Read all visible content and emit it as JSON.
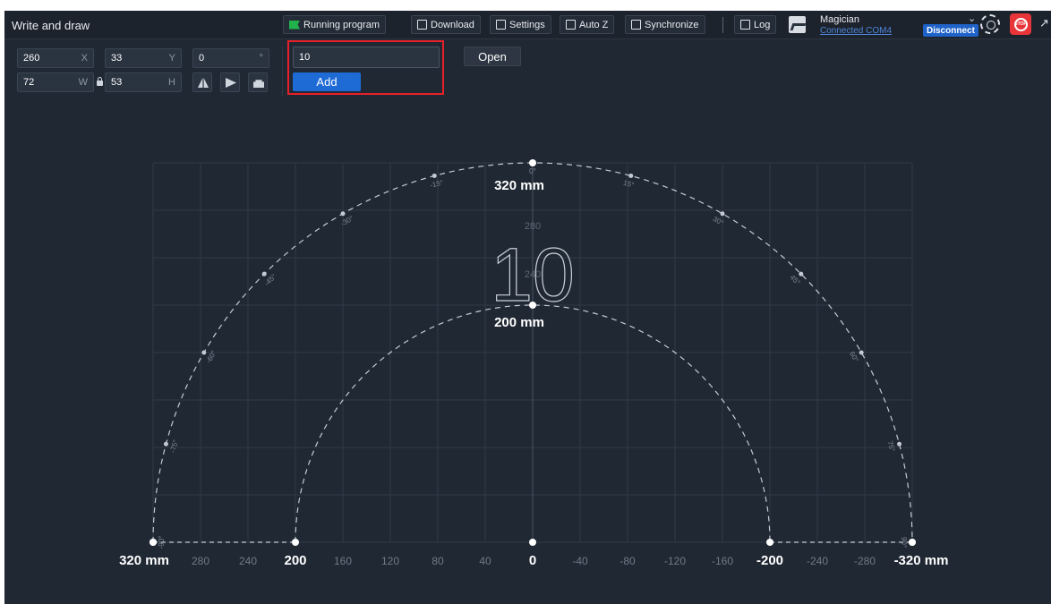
{
  "app": {
    "title": "Write and draw"
  },
  "toolbar": {
    "running_program": "Running program",
    "download": "Download",
    "settings": "Settings",
    "auto_z": "Auto Z",
    "synchronize": "Synchronize",
    "log": "Log"
  },
  "device": {
    "name": "Magician",
    "status": "Connected COM4",
    "disconnect": "Disconnect",
    "stop": "STOP"
  },
  "params": {
    "x": {
      "value": "260",
      "suffix": "X"
    },
    "y": {
      "value": "33",
      "suffix": "Y"
    },
    "r": {
      "value": "0",
      "suffix": "°"
    },
    "w": {
      "value": "72",
      "suffix": "W"
    },
    "h": {
      "value": "53",
      "suffix": "H"
    }
  },
  "text_entry": {
    "value": "10"
  },
  "buttons": {
    "add": "Add",
    "open": "Open"
  },
  "canvas": {
    "object_text": "10",
    "outer_label": "320 mm",
    "inner_label": "200 mm",
    "mark_280": "280",
    "mark_240": "240",
    "x_ticks": [
      "320 mm",
      "280",
      "240",
      "200",
      "160",
      "120",
      "80",
      "40",
      "0",
      "-40",
      "-80",
      "-120",
      "-160",
      "-200",
      "-240",
      "-280",
      "-320 mm"
    ],
    "angle_labels": [
      "-90°",
      "-75°",
      "-60°",
      "-45°",
      "-30°",
      "-15°",
      "0°",
      "15°",
      "30°",
      "45°",
      "60°",
      "75°",
      "90°"
    ]
  },
  "colors": {
    "background": "#202833",
    "grid": "#2f3a47",
    "accent": "#1e6bd6",
    "highlight": "#e8202a",
    "stop": "#e8353a",
    "link": "#4f86d8"
  }
}
